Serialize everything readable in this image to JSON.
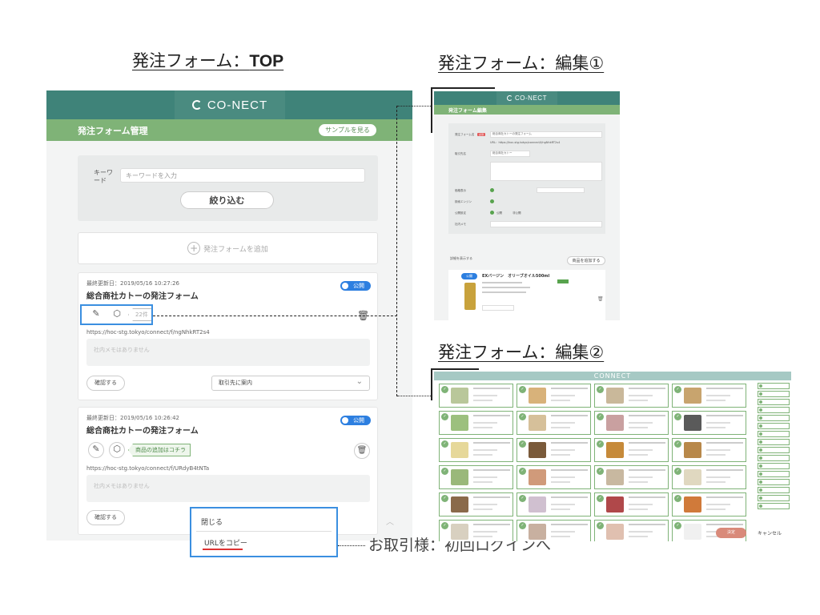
{
  "captions": {
    "top_prefix": "発注フォーム：",
    "top_bold": "TOP",
    "edit1": "発注フォーム：編集①",
    "edit2": "発注フォーム：編集②"
  },
  "app": {
    "logo": "CO-NECT",
    "page_title": "発注フォーム管理",
    "sample_button": "サンプルを見る"
  },
  "search": {
    "label": "キーワード",
    "placeholder": "キーワードを入力",
    "filter_button": "絞り込む"
  },
  "add_form": "発注フォームを追加",
  "forms": [
    {
      "updated": "最終更新日：2019/05/16 10:27:26",
      "title": "総合商社カトーの発注フォーム",
      "status": "公開",
      "count": "22件",
      "url": "https://hoc-stg.tokyo/connect/f/ngNhkRT2s4",
      "memo": "社内メモはありません",
      "confirm": "確認する",
      "select": "取引先に案内"
    },
    {
      "updated": "最終更新日：2019/05/16 10:26:42",
      "title": "総合商社カトーの発注フォーム",
      "status": "公開",
      "add_items": "商品の追加はコチラ",
      "url": "https://hoc-stg.tokyo/connect/f/URdyB4tNTa",
      "memo": "社内メモはありません",
      "confirm": "確認する"
    }
  ],
  "dropdown": {
    "close": "閉じる",
    "copy_url": "URLをコピー"
  },
  "note": "お取引様：初回ログインへ",
  "edit1": {
    "logo": "CO-NECT",
    "title": "発注フォーム編集",
    "form_name_label": "発注フォーム名",
    "required": "必須",
    "form_name_value": "総合商社カトーの発注フォーム",
    "url_line": "URL：https://hoc-stg.tokyo/connect/f/ngNhkRT2s4",
    "client_label": "取引先名",
    "client_value": "総合商社カトー",
    "price_label": "価格表示",
    "search_label": "検索エンジン",
    "public_label": "公開設定",
    "public_on": "公開",
    "public_off": "非公開",
    "memo_label": "社内メモ",
    "show_detail": "詳細を表示する",
    "add_product": "商品を追加する",
    "product_status": "公開",
    "product_name": "EXバージン　オリーブオイル500ml"
  },
  "edit2": {
    "logo": "CONNECT",
    "ok_button": "決定",
    "cancel_button": "キャンセル"
  },
  "colors": {
    "header_green": "#3f8379",
    "sub_green": "#7fb377",
    "highlight_blue": "#3b8fe0",
    "toggle_blue": "#2d7fe0"
  }
}
